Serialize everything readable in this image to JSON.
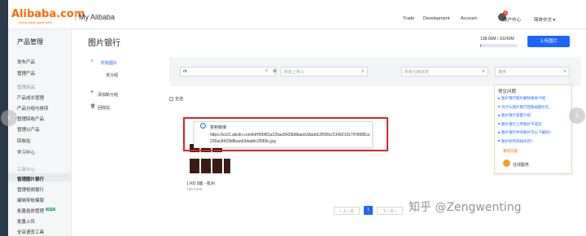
{
  "header": {
    "logo_text": "Alibaba.com",
    "logo_tagline": "Global trade starts here.",
    "title": "My Alibaba",
    "nav": [
      "Trade",
      "Development",
      "Account"
    ],
    "account_label": "账户中心",
    "lang_label": "简体中文",
    "notification_count": "6"
  },
  "sidebar": {
    "title": "产品管理",
    "items": [
      {
        "label": "发布产品",
        "kind": "normal"
      },
      {
        "label": "管理产品",
        "kind": "normal"
      },
      {
        "label": "管理商品",
        "kind": "muted"
      },
      {
        "label": "产品成长管理",
        "kind": "normal"
      },
      {
        "label": "产品分组与排序",
        "kind": "normal"
      },
      {
        "label": "管理回收产品",
        "kind": "normal"
      },
      {
        "label": "管理以产品",
        "kind": "normal"
      },
      {
        "label": "回收站",
        "kind": "normal"
      },
      {
        "label": "学习中心",
        "kind": "normal"
      },
      {
        "label": "工具中心",
        "kind": "muted"
      },
      {
        "label": "管理图片银行",
        "kind": "active"
      },
      {
        "label": "管理视频银行",
        "kind": "normal"
      },
      {
        "label": "编辑导航模版",
        "kind": "normal"
      },
      {
        "label": "批量投放管理",
        "kind": "normal",
        "badge": "NEW"
      },
      {
        "label": "批量上传",
        "kind": "normal"
      },
      {
        "label": "全店速查工具",
        "kind": "normal"
      }
    ]
  },
  "main": {
    "page_title": "图片银行",
    "storage_text": "138.06M / 10240M",
    "storage_fraction": 0.013,
    "upload_button": "上传图片",
    "folders": {
      "all": "所有图片",
      "ungrouped": "未分组",
      "add_group": "添加新分组",
      "recycle": "回收站"
    },
    "filters": {
      "search_value": "rd",
      "uploader_placeholder": "所有上传人",
      "reference_placeholder": "所有引用状态",
      "sort_placeholder": "排序"
    },
    "select_all": "全选",
    "image": {
      "name": "1 RD 9篇 - 杭州",
      "dimensions": "750*1000"
    },
    "tooltip": {
      "label": "复制链接:",
      "url": "https://sc01.alicdn.com/kf/H06f81a235ac8433b8baeb3daddc2f089c/234921917/H06f81a235ac8433b8baeb3daddc2f089c.jpg"
    },
    "pagination": {
      "prev": "< 上一页",
      "current": "1",
      "next": "下一页 >"
    }
  },
  "faq": {
    "title": "常见问题",
    "questions": [
      "图片银行图片删除相关介绍",
      "为什么图片银行回收站图片在...",
      "图片银行容量介绍",
      "图片银行上传图片不成功",
      "图片银行中的图片可以下载吗?",
      "图片如何添加水印?"
    ],
    "more": "我的问题",
    "online": "在线服务"
  },
  "watermark": "知乎 @Zengwenting",
  "colors": {
    "accent": "#1a66ff",
    "brand": "#ff6a00",
    "highlight_box": "#d8232a"
  }
}
